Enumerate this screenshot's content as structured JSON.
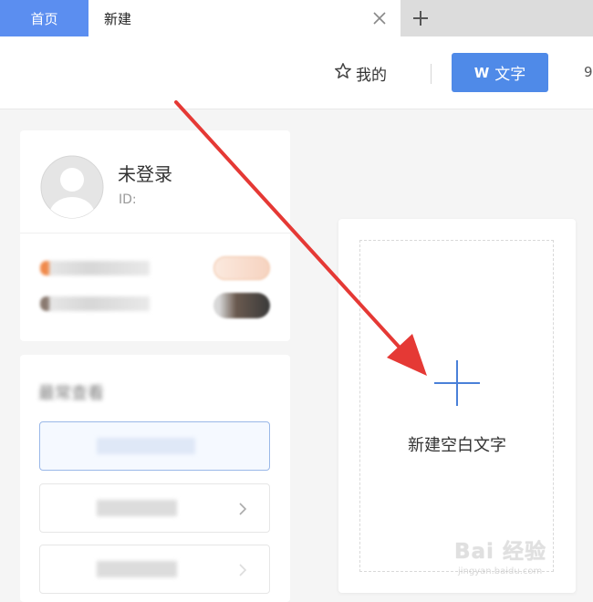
{
  "tabs": {
    "home_label": "首页",
    "new_label": "新建"
  },
  "toolbar": {
    "mine_label": "我的",
    "text_button_label": "文字",
    "text_button_glyph": "W",
    "edge_glyph": "9"
  },
  "user_card": {
    "name": "未登录",
    "id_label": "ID:"
  },
  "recent": {
    "title": "最常查看"
  },
  "new_doc": {
    "label": "新建空白文字"
  },
  "watermark": {
    "main": "Bai 经验",
    "sub": "jingyan.baidu.com"
  },
  "colors": {
    "accent": "#4f8ae8",
    "home_tab": "#5b8ef0",
    "annotation_arrow": "#e53935"
  },
  "icons": {
    "tab_close": "close-icon",
    "tab_add": "plus-icon",
    "mine": "star-outline-icon",
    "new_doc": "plus-icon",
    "recent_item": "chevron-right-icon"
  }
}
